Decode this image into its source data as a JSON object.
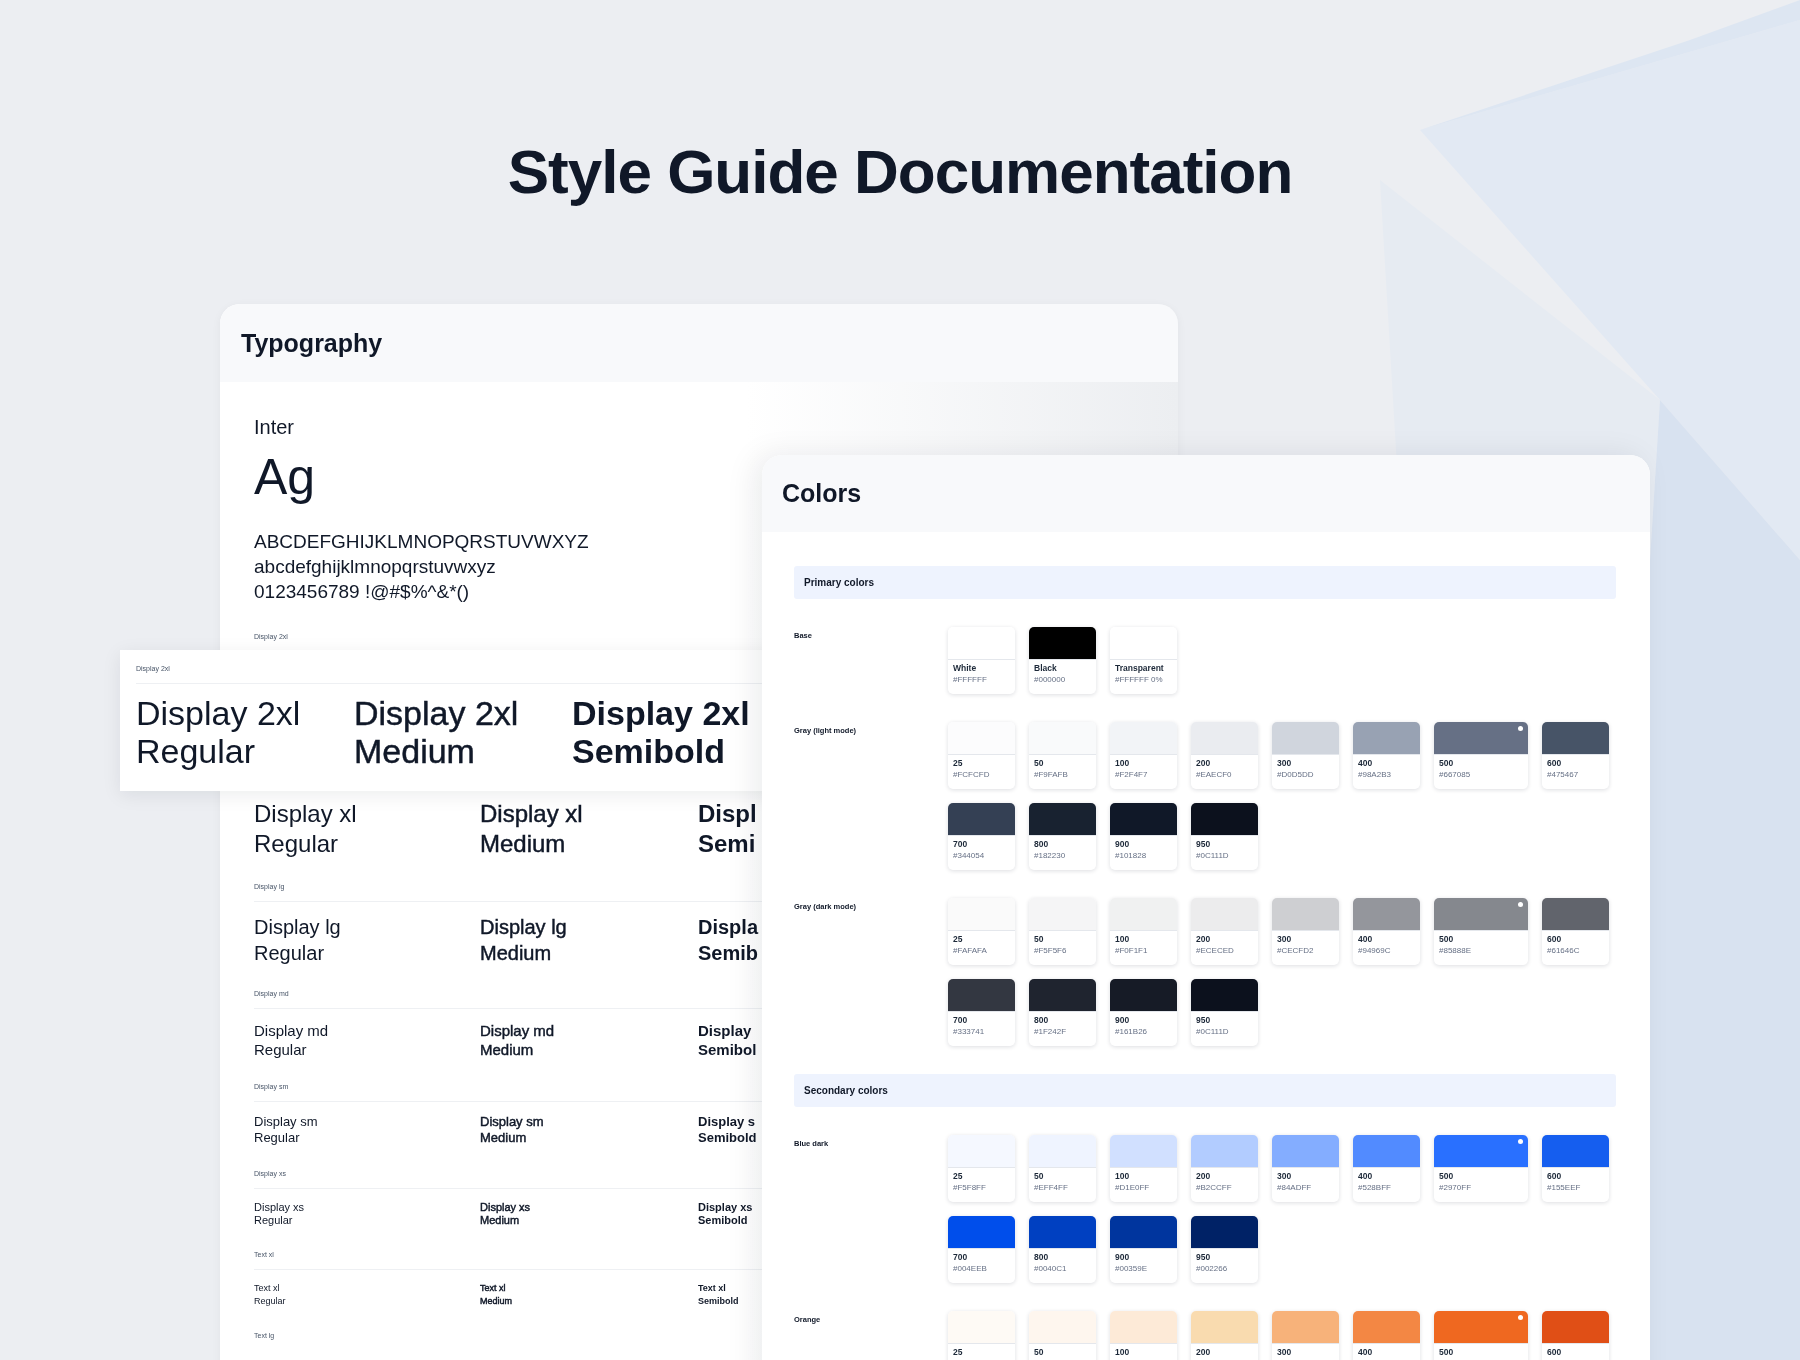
{
  "title": "Style Guide Documentation",
  "typography": {
    "title": "Typography",
    "font_name": "Inter",
    "sample": "Ag",
    "charset": [
      "ABCDEFGHIJKLMNOPQRSTUVWXYZ",
      "abcdefghijklmnopqrstuvwxyz",
      "0123456789 !@#$%^&*()"
    ],
    "featured": {
      "kind": "display-2xl",
      "label": "Display 2xl",
      "samples": [
        {
          "lines": [
            "Display 2xl",
            "Regular"
          ]
        },
        {
          "lines": [
            "Display 2xl",
            "Medium"
          ]
        },
        {
          "lines": [
            "Display 2xl",
            "Semibold"
          ]
        }
      ]
    },
    "rows": [
      {
        "kind": "display-2xl",
        "label": "Display 2xl"
      },
      {
        "kind": "display-xl",
        "samples": [
          {
            "lines": [
              "Display xl",
              "Regular"
            ]
          },
          {
            "lines": [
              "Display xl",
              "Medium"
            ]
          },
          {
            "lines": [
              "Displ",
              "Semi"
            ]
          }
        ]
      },
      {
        "kind": "display-lg",
        "label": "Display lg",
        "samples": [
          {
            "lines": [
              "Display lg",
              "Regular"
            ]
          },
          {
            "lines": [
              "Display lg",
              "Medium"
            ]
          },
          {
            "lines": [
              "Displa",
              "Semib"
            ]
          }
        ]
      },
      {
        "kind": "display-md",
        "label": "Display md",
        "samples": [
          {
            "lines": [
              "Display md",
              "Regular"
            ]
          },
          {
            "lines": [
              "Display md",
              "Medium"
            ]
          },
          {
            "lines": [
              "Display",
              "Semibol"
            ]
          }
        ]
      },
      {
        "kind": "display-sm",
        "label": "Display sm",
        "samples": [
          {
            "lines": [
              "Display sm",
              "Regular"
            ]
          },
          {
            "lines": [
              "Display sm",
              "Medium"
            ]
          },
          {
            "lines": [
              "Display s",
              "Semibold"
            ]
          }
        ]
      },
      {
        "kind": "display-xs",
        "label": "Display xs",
        "samples": [
          {
            "lines": [
              "Display xs",
              "Regular"
            ]
          },
          {
            "lines": [
              "Display xs",
              "Medium"
            ]
          },
          {
            "lines": [
              "Display xs",
              "Semibold"
            ]
          }
        ]
      },
      {
        "kind": "text-xl",
        "label": "Text xl",
        "samples": [
          {
            "lines": [
              "Text xl",
              "Regular"
            ]
          },
          {
            "lines": [
              "Text xl",
              "Medium"
            ]
          },
          {
            "lines": [
              "Text xl",
              "Semibold"
            ]
          }
        ]
      },
      {
        "kind": "text-lg",
        "label": "Text lg"
      }
    ]
  },
  "colors": {
    "title": "Colors",
    "sections": [
      {
        "title": "Primary colors",
        "groups": [
          {
            "name": "Base",
            "swatches": [
              {
                "name": "White",
                "hex": "#FFFFFF",
                "color": "#ffffff",
                "highlighted": false
              },
              {
                "name": "Black",
                "hex": "#000000",
                "color": "#000000",
                "highlighted": false
              },
              {
                "name": "Transparent",
                "hex": "#FFFFFF 0%",
                "color": "#ffffff",
                "highlighted": false
              }
            ]
          },
          {
            "name": "Gray (light mode)",
            "swatches": [
              {
                "name": "25",
                "hex": "#FCFCFD",
                "color": "#fcfcfd",
                "highlighted": false
              },
              {
                "name": "50",
                "hex": "#F9FAFB",
                "color": "#f9fafb",
                "highlighted": false
              },
              {
                "name": "100",
                "hex": "#F2F4F7",
                "color": "#f2f4f7",
                "highlighted": false
              },
              {
                "name": "200",
                "hex": "#EAECF0",
                "color": "#eaecf0",
                "highlighted": false
              },
              {
                "name": "300",
                "hex": "#D0D5DD",
                "color": "#d0d5dd",
                "highlighted": false
              },
              {
                "name": "400",
                "hex": "#98A2B3",
                "color": "#98a2b3",
                "highlighted": false
              },
              {
                "name": "500",
                "hex": "#667085",
                "color": "#667085",
                "highlighted": true
              },
              {
                "name": "600",
                "hex": "#475467",
                "color": "#475467",
                "highlighted": false
              },
              {
                "name": "700",
                "hex": "#344054",
                "color": "#344054",
                "highlighted": false
              },
              {
                "name": "800",
                "hex": "#182230",
                "color": "#182230",
                "highlighted": false
              },
              {
                "name": "900",
                "hex": "#101828",
                "color": "#101828",
                "highlighted": false
              },
              {
                "name": "950",
                "hex": "#0C111D",
                "color": "#0c111d",
                "highlighted": false
              }
            ]
          },
          {
            "name": "Gray (dark mode)",
            "swatches": [
              {
                "name": "25",
                "hex": "#FAFAFA",
                "color": "#fafafa",
                "highlighted": false
              },
              {
                "name": "50",
                "hex": "#F5F5F6",
                "color": "#f5f5f6",
                "highlighted": false
              },
              {
                "name": "100",
                "hex": "#F0F1F1",
                "color": "#f0f1f1",
                "highlighted": false
              },
              {
                "name": "200",
                "hex": "#ECECED",
                "color": "#ececed",
                "highlighted": false
              },
              {
                "name": "300",
                "hex": "#CECFD2",
                "color": "#cecfd2",
                "highlighted": false
              },
              {
                "name": "400",
                "hex": "#94969C",
                "color": "#94969c",
                "highlighted": false
              },
              {
                "name": "500",
                "hex": "#85888E",
                "color": "#85888e",
                "highlighted": true
              },
              {
                "name": "600",
                "hex": "#61646C",
                "color": "#61646c",
                "highlighted": false
              },
              {
                "name": "700",
                "hex": "#333741",
                "color": "#333741",
                "highlighted": false
              },
              {
                "name": "800",
                "hex": "#1F242F",
                "color": "#1f242f",
                "highlighted": false
              },
              {
                "name": "900",
                "hex": "#161B26",
                "color": "#161b26",
                "highlighted": false
              },
              {
                "name": "950",
                "hex": "#0C111D",
                "color": "#0c111d",
                "highlighted": false
              }
            ]
          }
        ]
      },
      {
        "title": "Secondary colors",
        "groups": [
          {
            "name": "Blue dark",
            "swatches": [
              {
                "name": "25",
                "hex": "#F5F8FF",
                "color": "#f5f8ff",
                "highlighted": false
              },
              {
                "name": "50",
                "hex": "#EFF4FF",
                "color": "#eff4ff",
                "highlighted": false
              },
              {
                "name": "100",
                "hex": "#D1E0FF",
                "color": "#d1e0ff",
                "highlighted": false
              },
              {
                "name": "200",
                "hex": "#B2CCFF",
                "color": "#b2ccff",
                "highlighted": false
              },
              {
                "name": "300",
                "hex": "#84ADFF",
                "color": "#84adff",
                "highlighted": false
              },
              {
                "name": "400",
                "hex": "#528BFF",
                "color": "#528bff",
                "highlighted": false
              },
              {
                "name": "500",
                "hex": "#2970FF",
                "color": "#2970ff",
                "highlighted": true
              },
              {
                "name": "600",
                "hex": "#155EEF",
                "color": "#155eef",
                "highlighted": false
              },
              {
                "name": "700",
                "hex": "#004EEB",
                "color": "#004eeb",
                "highlighted": false
              },
              {
                "name": "800",
                "hex": "#0040C1",
                "color": "#0040c1",
                "highlighted": false
              },
              {
                "name": "900",
                "hex": "#00359E",
                "color": "#00359e",
                "highlighted": false
              },
              {
                "name": "950",
                "hex": "#002266",
                "color": "#002266",
                "highlighted": false
              }
            ]
          },
          {
            "name": "Orange",
            "swatches": [
              {
                "name": "25",
                "color": "#fefaf5",
                "highlighted": false
              },
              {
                "name": "50",
                "color": "#fef6ee",
                "highlighted": false
              },
              {
                "name": "100",
                "color": "#fdead7",
                "highlighted": false
              },
              {
                "name": "200",
                "color": "#f9dbaf",
                "highlighted": false
              },
              {
                "name": "300",
                "color": "#f7b27a",
                "highlighted": false
              },
              {
                "name": "400",
                "color": "#f38744",
                "highlighted": false
              },
              {
                "name": "500",
                "color": "#ef6820",
                "highlighted": true
              },
              {
                "name": "600",
                "color": "#e04f16",
                "highlighted": false
              }
            ]
          }
        ]
      }
    ]
  }
}
